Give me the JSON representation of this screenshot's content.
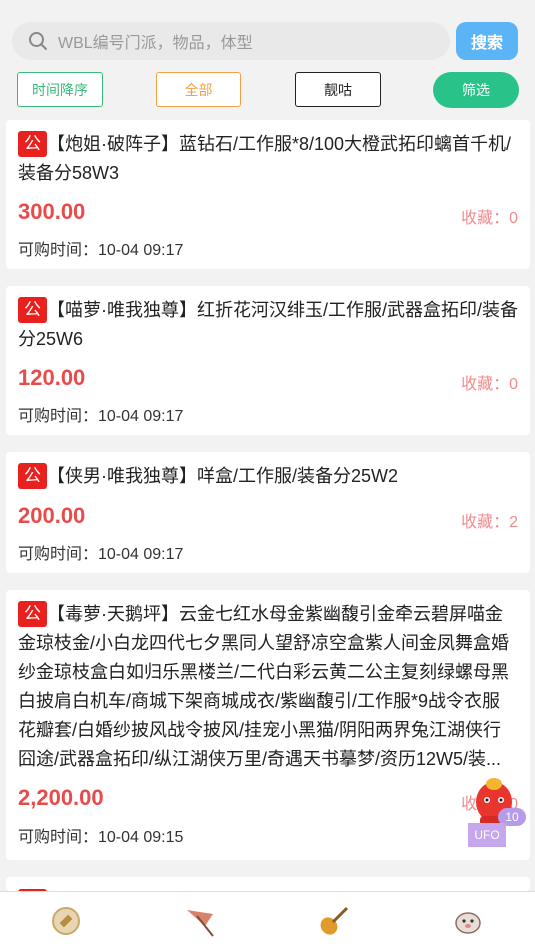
{
  "search": {
    "placeholder": "WBL编号门派，物品，体型",
    "button_label": "搜索"
  },
  "filters": {
    "time_sort": "时间降序",
    "all": "全部",
    "pretty": "靓咕",
    "filter": "筛选"
  },
  "badge_label": "公",
  "listings": [
    {
      "title": "【炮姐·破阵子】蓝钻石/工作服*8/100大橙武拓印螭首千机/装备分58W3",
      "price": "300.00",
      "favorites": "收藏：0",
      "buy_time": "可购时间：10-04 09:17"
    },
    {
      "title": "【喵萝·唯我独尊】红折花河汉绯玉/工作服/武器盒拓印/装备分25W6",
      "price": "120.00",
      "favorites": "收藏：0",
      "buy_time": "可购时间：10-04 09:17"
    },
    {
      "title": "【侠男·唯我独尊】咩盒/工作服/装备分25W2",
      "price": "200.00",
      "favorites": "收藏：2",
      "buy_time": "可购时间：10-04 09:17"
    },
    {
      "title": "【毒萝·天鹅坪】云金七红水母金紫幽馥引金牵云碧屏喵金金琼枝金/小白龙四代七夕黑同人望舒凉空盒紫人间金凤舞盒婚纱金琼枝盒白如归乐黑楼兰/二代白彩云黄二公主复刻绿螺母黑白披肩白机车/商城下架商城成衣/紫幽馥引/工作服*9战令衣服花瓣套/白婚纱披风战令披风/挂宠小黑猫/阴阳两界兔江湖侠行囧途/武器盒拓印/纵江湖侠万里/奇遇天书摹梦/资历12W5/装...",
      "price": "2,200.00",
      "favorites": "收藏：0",
      "buy_time": "可购时间：10-04 09:15"
    }
  ],
  "mascot": {
    "badge": "10",
    "label": "UFO"
  },
  "nav": {
    "items": [
      "coin-icon",
      "umbrella-icon",
      "pipa-icon",
      "pet-icon"
    ]
  },
  "colors": {
    "search_button": "#5ab4f6",
    "price": "#e94b4b",
    "favorites": "#f08c8c",
    "badge": "#e8201e",
    "filter_green": "#29c38a"
  }
}
